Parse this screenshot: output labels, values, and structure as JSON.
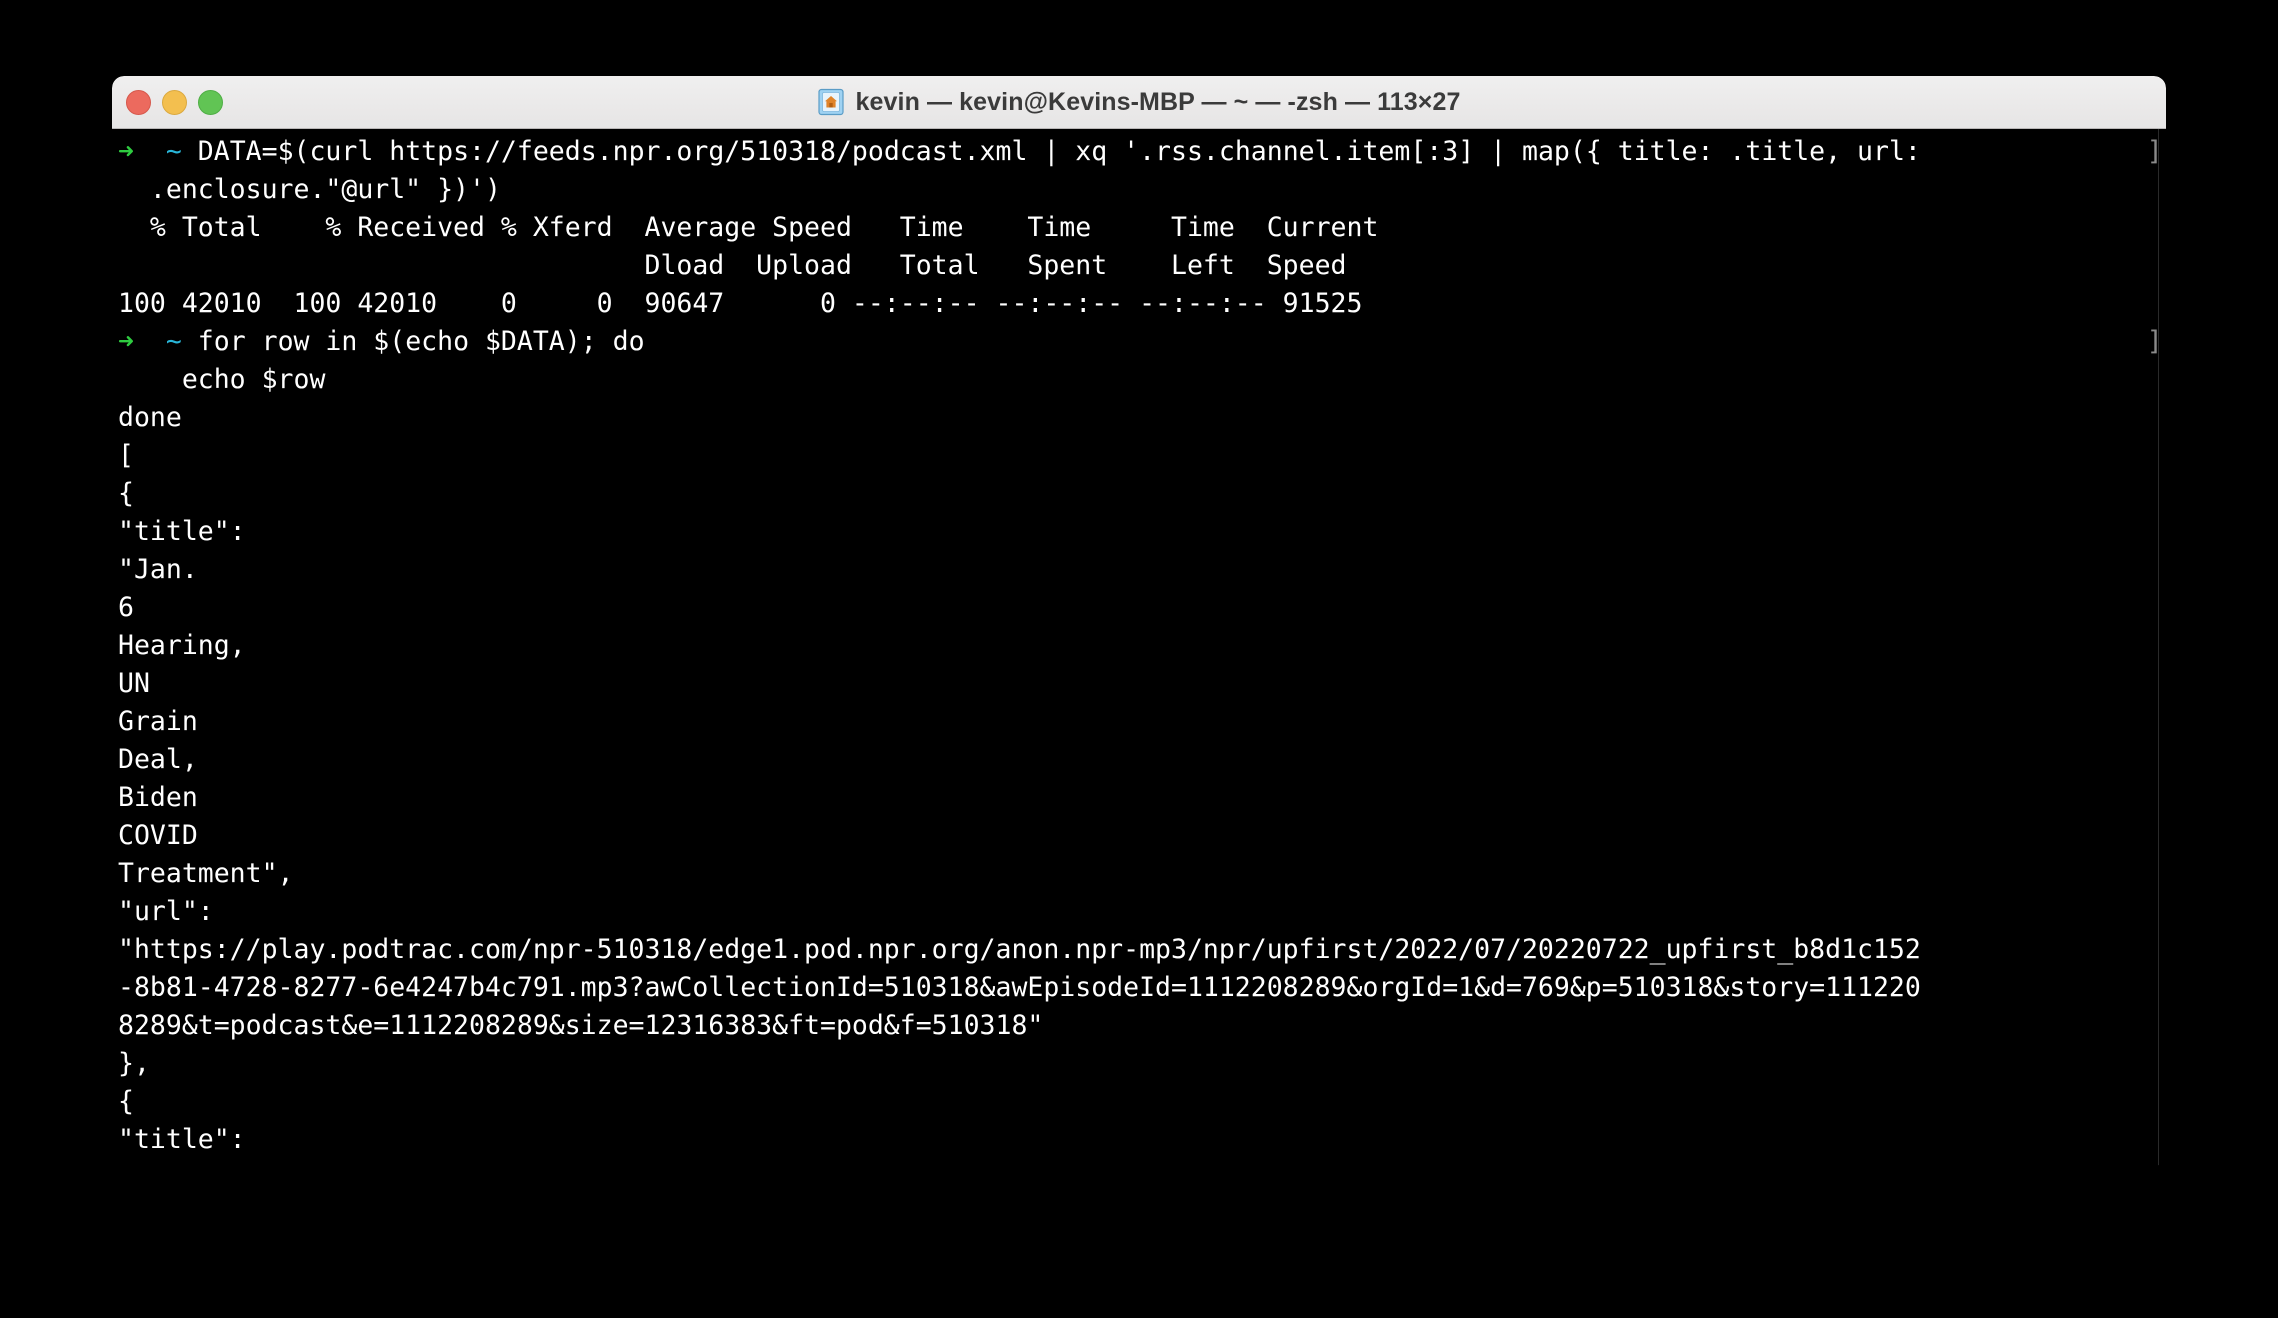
{
  "window": {
    "title": "kevin — kevin@Kevins-MBP — ~ — -zsh — 113×27",
    "icon": "terminal-home-folder-icon",
    "traffic_lights": {
      "close_label": "close",
      "minimize_label": "minimize",
      "zoom_label": "zoom",
      "close_color": "#ec6a5e",
      "minimize_color": "#f3bf4f",
      "zoom_color": "#61c454"
    },
    "columns": 113,
    "rows": 27,
    "shell": "-zsh",
    "user": "kevin",
    "host": "Kevins-MBP",
    "cwd": "~"
  },
  "theme": {
    "background": "#000000",
    "foreground": "#ffffff",
    "prompt_arrow_color": "#2ecc40",
    "prompt_path_color": "#29b6d8",
    "dim_color": "#8a8a8a",
    "titlebar_background": "#ebeaea",
    "titlebar_text": "#3b3b3b"
  },
  "prompt": {
    "arrow": "➜",
    "path": "~",
    "end_bracket": "]"
  },
  "terminal": {
    "lines": [
      {
        "id": "cmd1-a",
        "type": "command",
        "prompt": true,
        "text": "DATA=$(curl https://feeds.npr.org/510318/podcast.xml | xq '.rss.channel.item[:3] | map({ title: .title, url:",
        "edge_bracket": true
      },
      {
        "id": "cmd1-b",
        "type": "command-continuation",
        "prompt": false,
        "text": "  .enclosure.\"@url\" })')"
      },
      {
        "id": "curl-hdr1",
        "type": "output",
        "prompt": false,
        "text": "  % Total    % Received % Xferd  Average Speed   Time    Time     Time  Current"
      },
      {
        "id": "curl-hdr2",
        "type": "output",
        "prompt": false,
        "text": "                                 Dload  Upload   Total   Spent    Left  Speed"
      },
      {
        "id": "curl-row",
        "type": "output",
        "prompt": false,
        "text": "100 42010  100 42010    0     0  90647      0 --:--:-- --:--:-- --:--:-- 91525"
      },
      {
        "id": "cmd2-a",
        "type": "command",
        "prompt": true,
        "text": "for row in $(echo $DATA); do",
        "edge_bracket": true
      },
      {
        "id": "cmd2-b",
        "type": "command-continuation",
        "prompt": false,
        "text": "    echo $row"
      },
      {
        "id": "out-done",
        "type": "output",
        "prompt": false,
        "text": "done"
      },
      {
        "id": "out-01",
        "type": "output",
        "prompt": false,
        "text": "["
      },
      {
        "id": "out-02",
        "type": "output",
        "prompt": false,
        "text": "{"
      },
      {
        "id": "out-03",
        "type": "output",
        "prompt": false,
        "text": "\"title\":"
      },
      {
        "id": "out-04",
        "type": "output",
        "prompt": false,
        "text": "\"Jan."
      },
      {
        "id": "out-05",
        "type": "output",
        "prompt": false,
        "text": "6"
      },
      {
        "id": "out-06",
        "type": "output",
        "prompt": false,
        "text": "Hearing,"
      },
      {
        "id": "out-07",
        "type": "output",
        "prompt": false,
        "text": "UN"
      },
      {
        "id": "out-08",
        "type": "output",
        "prompt": false,
        "text": "Grain"
      },
      {
        "id": "out-09",
        "type": "output",
        "prompt": false,
        "text": "Deal,"
      },
      {
        "id": "out-10",
        "type": "output",
        "prompt": false,
        "text": "Biden"
      },
      {
        "id": "out-11",
        "type": "output",
        "prompt": false,
        "text": "COVID"
      },
      {
        "id": "out-12",
        "type": "output",
        "prompt": false,
        "text": "Treatment\","
      },
      {
        "id": "out-13",
        "type": "output",
        "prompt": false,
        "text": "\"url\":"
      },
      {
        "id": "out-14",
        "type": "output",
        "prompt": false,
        "text": "\"https://play.podtrac.com/npr-510318/edge1.pod.npr.org/anon.npr-mp3/npr/upfirst/2022/07/20220722_upfirst_b8d1c152"
      },
      {
        "id": "out-15",
        "type": "output",
        "prompt": false,
        "text": "-8b81-4728-8277-6e4247b4c791.mp3?awCollectionId=510318&awEpisodeId=1112208289&orgId=1&d=769&p=510318&story=111220"
      },
      {
        "id": "out-16",
        "type": "output",
        "prompt": false,
        "text": "8289&t=podcast&e=1112208289&size=12316383&ft=pod&f=510318\""
      },
      {
        "id": "out-17",
        "type": "output",
        "prompt": false,
        "text": "},"
      },
      {
        "id": "out-18",
        "type": "output",
        "prompt": false,
        "text": "{"
      },
      {
        "id": "out-19",
        "type": "output",
        "prompt": false,
        "text": "\"title\":"
      }
    ]
  }
}
